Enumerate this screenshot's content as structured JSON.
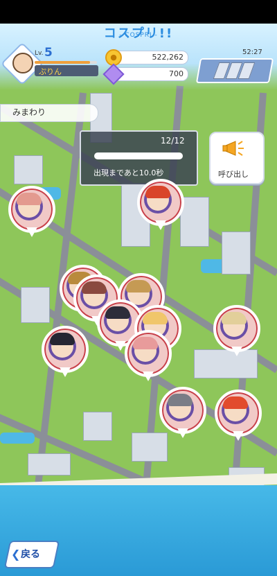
{
  "header": {
    "logo_text": "コスプリ!!",
    "logo_sub": "- COSPRI -"
  },
  "player": {
    "level_label": "Lv.",
    "level": "5",
    "name": "ぷりん",
    "exp_progress": 0.88
  },
  "currency": {
    "coins": "522,262",
    "gems": "700"
  },
  "timer": "52:27",
  "patrol": {
    "label": "みまわり",
    "count": "12/12",
    "message": "出現まであと10.0秒"
  },
  "call_button": {
    "label": "呼び出し"
  },
  "back_button": {
    "label": "戻る"
  },
  "colors": {
    "accent_blue": "#2c8de0",
    "pin_border": "#c8404a",
    "gold": "#f7c531",
    "gem": "#b08cf0"
  },
  "pins": [
    {
      "name": "pin-pink-hair",
      "hair": "#e39a8f"
    },
    {
      "name": "pin-red-hair-top",
      "hair": "#d9452a"
    },
    {
      "name": "pin-brown-hair",
      "hair": "#b98a3c"
    },
    {
      "name": "pin-brown-wavy",
      "hair": "#8a4a3f"
    },
    {
      "name": "pin-blond-hair",
      "hair": "#c59a54"
    },
    {
      "name": "pin-glasses-dark",
      "hair": "#2d2d3a"
    },
    {
      "name": "pin-blond-boy",
      "hair": "#f0c66b"
    },
    {
      "name": "pin-pink-closed",
      "hair": "#e89b9b"
    },
    {
      "name": "pin-glasses-black",
      "hair": "#262633"
    },
    {
      "name": "pin-beige-hair",
      "hair": "#e2cf9a"
    },
    {
      "name": "pin-gray-glasses",
      "hair": "#7a7d86"
    },
    {
      "name": "pin-red-hair-bottom",
      "hair": "#e24b2d"
    }
  ]
}
